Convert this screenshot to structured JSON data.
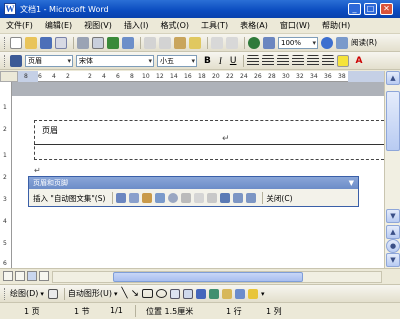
{
  "window": {
    "title": "文档1 - Microsoft Word"
  },
  "menu": [
    "文件(F)",
    "编辑(E)",
    "视图(V)",
    "插入(I)",
    "格式(O)",
    "工具(T)",
    "表格(A)",
    "窗口(W)",
    "帮助(H)"
  ],
  "toolbar1": {
    "zoom": "100%",
    "read_label": "阅读(R)"
  },
  "toolbar2": {
    "style": "页眉",
    "font": "宋体",
    "size": "小五"
  },
  "ruler": {
    "h_ticks": [
      "8",
      "6",
      "4",
      "2",
      "2",
      "4",
      "6",
      "8",
      "10",
      "12",
      "14",
      "16",
      "18",
      "20",
      "22",
      "24",
      "26",
      "28",
      "30",
      "32",
      "34",
      "36",
      "38"
    ],
    "v_ticks": [
      "1",
      "2",
      "1",
      "2",
      "3",
      "4",
      "5",
      "6"
    ]
  },
  "document": {
    "header_label": "页眉",
    "cursor_mark": "↵",
    "para_mark": "↵"
  },
  "hf_toolbar": {
    "title": "页眉和页脚",
    "autotext": "插入 \"自动图文集\"(S)",
    "close": "关闭(C)"
  },
  "draw_toolbar": {
    "draw": "绘图(D)",
    "autoshapes": "自动图形(U)"
  },
  "status": {
    "page": "1 页",
    "section": "1 节",
    "ratio": "1/1",
    "position": "位置 1.5厘米",
    "row": "1 行",
    "col": "1 列"
  },
  "colors": {
    "title_bar": "#0a4bbf",
    "hf_title": "#7a98d0",
    "doc_gray": "#aeb2b9"
  }
}
